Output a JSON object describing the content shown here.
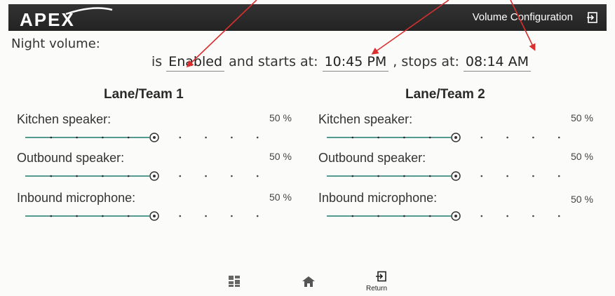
{
  "header": {
    "logo_text": "APEX",
    "title": "Volume Configuration",
    "exit_icon": "exit-icon"
  },
  "night_volume": {
    "label": "Night volume:",
    "prefix": "is",
    "status": "Enabled",
    "starts_text": "and starts at:",
    "start_time": "10:45 PM",
    "stops_text": ", stops at:",
    "stop_time": "08:14 AM"
  },
  "lanes": [
    {
      "title": "Lane/Team 1",
      "rows": [
        {
          "label": "Kitchen speaker:",
          "value": "50 %",
          "level": 50
        },
        {
          "label": "Outbound speaker:",
          "value": "50 %",
          "level": 50
        },
        {
          "label": "Inbound microphone:",
          "value": "50 %",
          "level": 50
        }
      ]
    },
    {
      "title": "Lane/Team 2",
      "rows": [
        {
          "label": "Kitchen speaker:",
          "value": "50 %",
          "level": 50
        },
        {
          "label": "Outbound speaker:",
          "value": "50 %",
          "level": 50
        },
        {
          "label": "Inbound microphone:",
          "value": "50 %",
          "level": 50
        }
      ]
    }
  ],
  "bottom_nav": {
    "apps_icon": "grid-icon",
    "home_icon": "home-icon",
    "return_icon": "exit-icon",
    "return_label": "Return"
  },
  "colors": {
    "header_bg": "#2b2b2b",
    "slider_track": "#1e7a6a",
    "annotation_arrow": "#d9302f"
  }
}
